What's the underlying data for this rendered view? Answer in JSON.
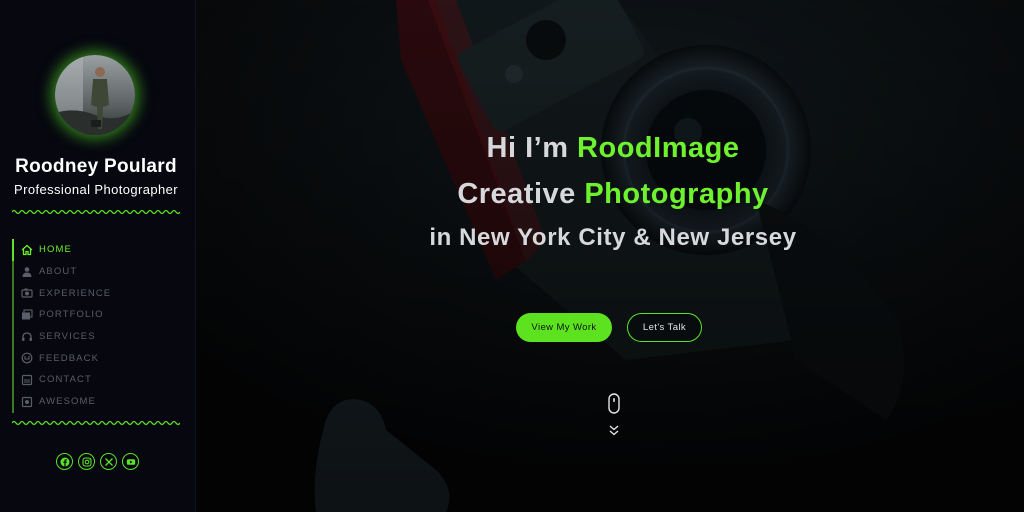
{
  "profile": {
    "name": "Roodney Poulard",
    "role": "Professional Photographer"
  },
  "nav": {
    "items": [
      {
        "label": "HOME",
        "icon": "home-icon",
        "active": true
      },
      {
        "label": "ABOUT",
        "icon": "user-icon",
        "active": false
      },
      {
        "label": "EXPERIENCE",
        "icon": "camera-icon",
        "active": false
      },
      {
        "label": "PORTFOLIO",
        "icon": "portfolio-icon",
        "active": false
      },
      {
        "label": "SERVICES",
        "icon": "headset-icon",
        "active": false
      },
      {
        "label": "FEEDBACK",
        "icon": "feedback-icon",
        "active": false
      },
      {
        "label": "CONTACT",
        "icon": "contact-icon",
        "active": false
      },
      {
        "label": "AWESOME",
        "icon": "image-icon",
        "active": false
      }
    ]
  },
  "socials": [
    "facebook-icon",
    "instagram-icon",
    "x-icon",
    "youtube-icon"
  ],
  "hero": {
    "line1_prefix": "Hi I’m ",
    "line1_accent": "RoodImage",
    "line2_prefix": "Creative ",
    "line2_accent": "Photography",
    "line3": "in New York City & New Jersey",
    "primary_button": "View My Work",
    "secondary_button": "Let's Talk"
  },
  "colors": {
    "accent": "#5be32a",
    "sidebar_bg": "#06070f",
    "nav_inactive": "#5a5d6a"
  }
}
